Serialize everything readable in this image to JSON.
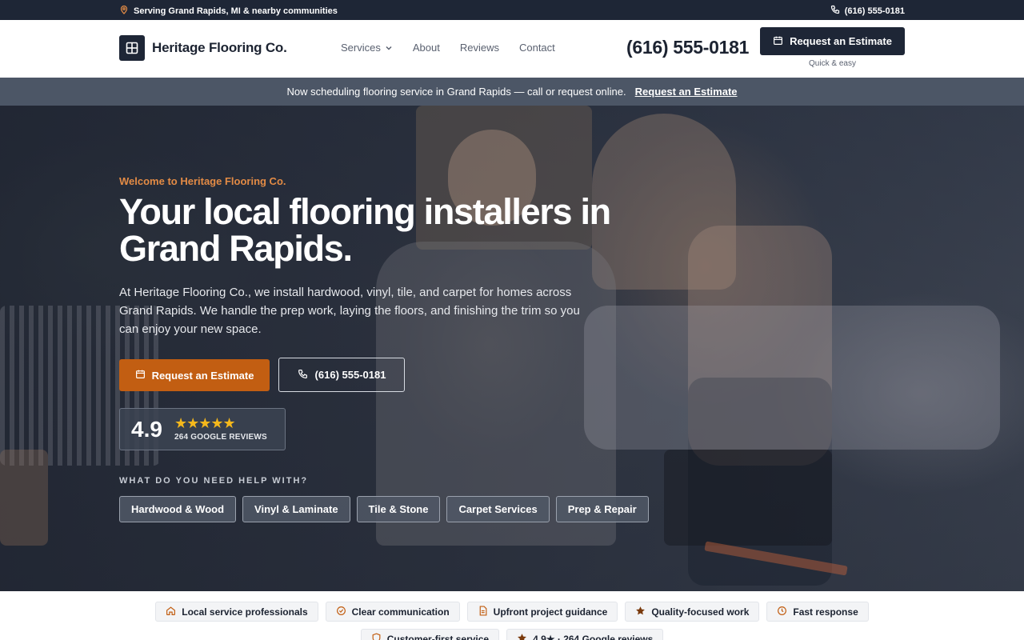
{
  "topbar": {
    "location": "Serving Grand Rapids, MI & nearby communities",
    "phone": "(616) 555-0181",
    "location_icon": "map-pin-icon",
    "phone_icon": "phone-icon"
  },
  "header": {
    "brand": "Heritage Flooring Co.",
    "nav": {
      "services": "Services",
      "about": "About",
      "reviews": "Reviews",
      "contact": "Contact"
    },
    "phone": "(616) 555-0181",
    "cta_label": "Request an Estimate",
    "cta_sub": "Quick & easy"
  },
  "announcement": {
    "text": "Now scheduling flooring service in Grand Rapids — call or request online.",
    "link": "Request an Estimate"
  },
  "hero": {
    "eyebrow": "Welcome to Heritage Flooring Co.",
    "headline": "Your local flooring installers in Grand Rapids.",
    "lead": "At Heritage Flooring Co., we install hardwood, vinyl, tile, and carpet for homes across Grand Rapids. We handle the prep work, laying the floors, and finishing the trim so you can enjoy your new space.",
    "primary_cta": "Request an Estimate",
    "phone_cta": "(616) 555-0181",
    "rating": {
      "score": "4.9",
      "stars": "★★★★★",
      "count": "264 GOOGLE REVIEWS"
    },
    "help_label": "WHAT DO YOU NEED HELP WITH?",
    "services": [
      "Hardwood & Wood",
      "Vinyl & Laminate",
      "Tile & Stone",
      "Carpet Services",
      "Prep & Repair"
    ]
  },
  "trust": {
    "row1": [
      {
        "label": "Local service professionals",
        "icon": "home-icon"
      },
      {
        "label": "Clear communication",
        "icon": "check-circle-icon"
      },
      {
        "label": "Upfront project guidance",
        "icon": "document-icon"
      },
      {
        "label": "Quality-focused work",
        "icon": "star-icon"
      },
      {
        "label": "Fast response",
        "icon": "clock-icon"
      }
    ],
    "row2": [
      {
        "label": "Customer-first service",
        "icon": "shield-icon"
      },
      {
        "label": "4.9★ · 264 Google reviews",
        "icon": "star-icon"
      }
    ]
  },
  "colors": {
    "navy": "#1e2636",
    "accent_orange": "#c25e12",
    "eyebrow_orange": "#e38b45",
    "star_gold": "#f5b81c"
  }
}
